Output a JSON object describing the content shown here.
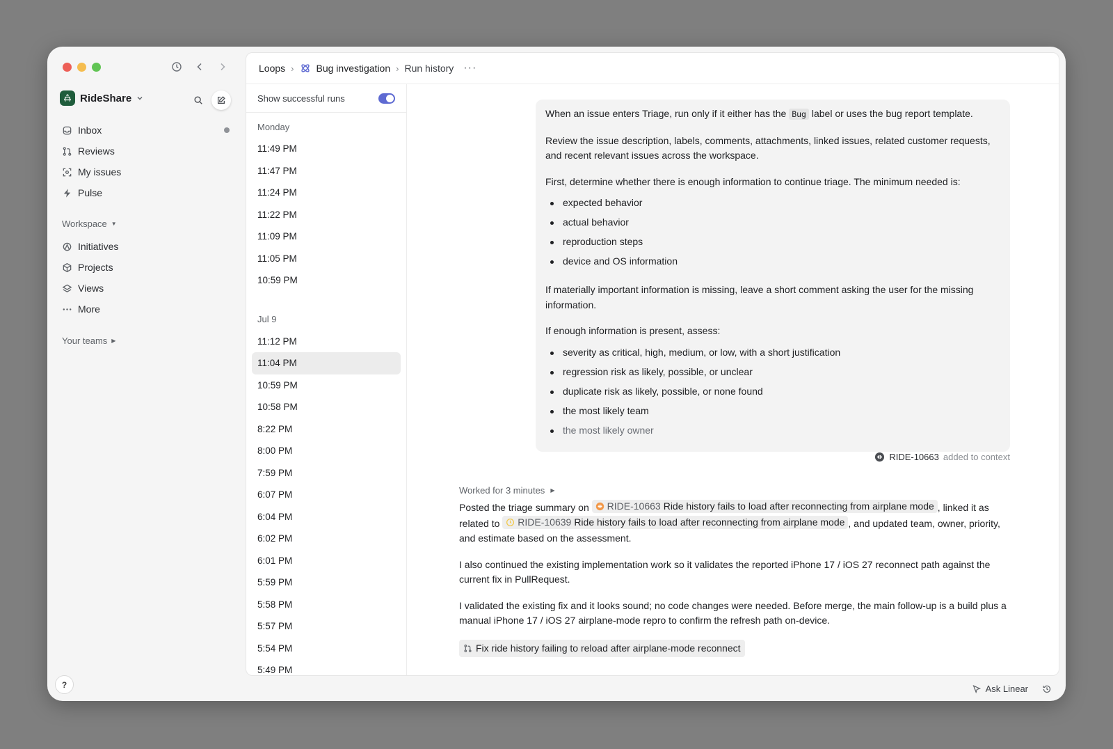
{
  "workspace": {
    "name": "RideShare"
  },
  "sidebar": {
    "items": [
      {
        "label": "Inbox",
        "icon": "inbox-icon",
        "unread": true
      },
      {
        "label": "Reviews",
        "icon": "pull-request-icon"
      },
      {
        "label": "My issues",
        "icon": "target-icon"
      },
      {
        "label": "Pulse",
        "icon": "pulse-icon"
      }
    ],
    "workspace_label": "Workspace",
    "workspace_items": [
      {
        "label": "Initiatives",
        "icon": "initiatives-icon"
      },
      {
        "label": "Projects",
        "icon": "cube-icon"
      },
      {
        "label": "Views",
        "icon": "layers-icon"
      },
      {
        "label": "More",
        "icon": "more-dots-icon"
      }
    ],
    "teams_label": "Your teams",
    "help_label": "?"
  },
  "breadcrumb": {
    "root": "Loops",
    "loop": "Bug investigation",
    "page": "Run history"
  },
  "runs": {
    "toggle_label": "Show successful runs",
    "toggle_on": true,
    "groups": [
      {
        "label": "Monday",
        "times": [
          "11:49 PM",
          "11:47 PM",
          "11:24 PM",
          "11:22 PM",
          "11:09 PM",
          "11:05 PM",
          "10:59 PM"
        ]
      },
      {
        "label": "Jul 9",
        "times": [
          "11:12 PM",
          "11:04 PM",
          "10:59 PM",
          "10:58 PM",
          "8:22 PM",
          "8:00 PM",
          "7:59 PM",
          "6:07 PM",
          "6:04 PM",
          "6:02 PM",
          "6:01 PM",
          "5:59 PM",
          "5:58 PM",
          "5:57 PM",
          "5:54 PM",
          "5:49 PM"
        ]
      }
    ],
    "selected": "11:04 PM"
  },
  "prompt": {
    "p1_before": "When an issue enters Triage, run only if it either has the",
    "p1_code": "Bug",
    "p1_after": "label or uses the bug report template.",
    "p2": "Review the issue description, labels, comments, attachments, linked issues, related customer requests, and recent relevant issues across the workspace.",
    "p3": "First, determine whether there is enough information to continue triage. The minimum needed is:",
    "list1": [
      "expected behavior",
      "actual behavior",
      "reproduction steps",
      "device and OS information"
    ],
    "p4": "If materially important information is missing, leave a short comment asking the user for the missing information.",
    "p5": "If enough information is present, assess:",
    "list2": [
      "severity as critical, high, medium, or low, with a short justification",
      "regression risk as likely, possible, or unclear",
      "duplicate risk as likely, possible, or none found",
      "the most likely team",
      "the most likely owner"
    ]
  },
  "context": {
    "id": "RIDE-10663",
    "note": "added to context"
  },
  "worked": {
    "label": "Worked for 3 minutes"
  },
  "reply": {
    "p1_a": "Posted the triage summary on",
    "chip1_id": "RIDE-10663",
    "chip1_title": "Ride history fails to load after reconnecting from airplane mode",
    "p1_b": ", linked it as related to",
    "chip2_id": "RIDE-10639",
    "chip2_title": "Ride history fails to load after reconnecting from airplane mode",
    "p1_c": ", and updated team, owner, priority, and estimate based on the assessment.",
    "p2": "I also continued the existing implementation work so it validates the reported iPhone 17 / iOS 27 reconnect path against the current fix in PullRequest.",
    "p3": "I validated the existing fix and it looks sound; no code changes were needed. Before merge, the main follow-up is a build plus a manual iPhone 17 / iOS 27 airplane-mode repro to confirm the refresh path on-device.",
    "pr_title": "Fix ride history failing to reload after airplane-mode reconnect"
  },
  "footer": {
    "ask_label": "Ask Linear"
  },
  "colors": {
    "accent": "#5e6ad2",
    "urgent": "#f2994a",
    "in_progress": "#f2c94c",
    "brand": "#1f5d3c"
  }
}
